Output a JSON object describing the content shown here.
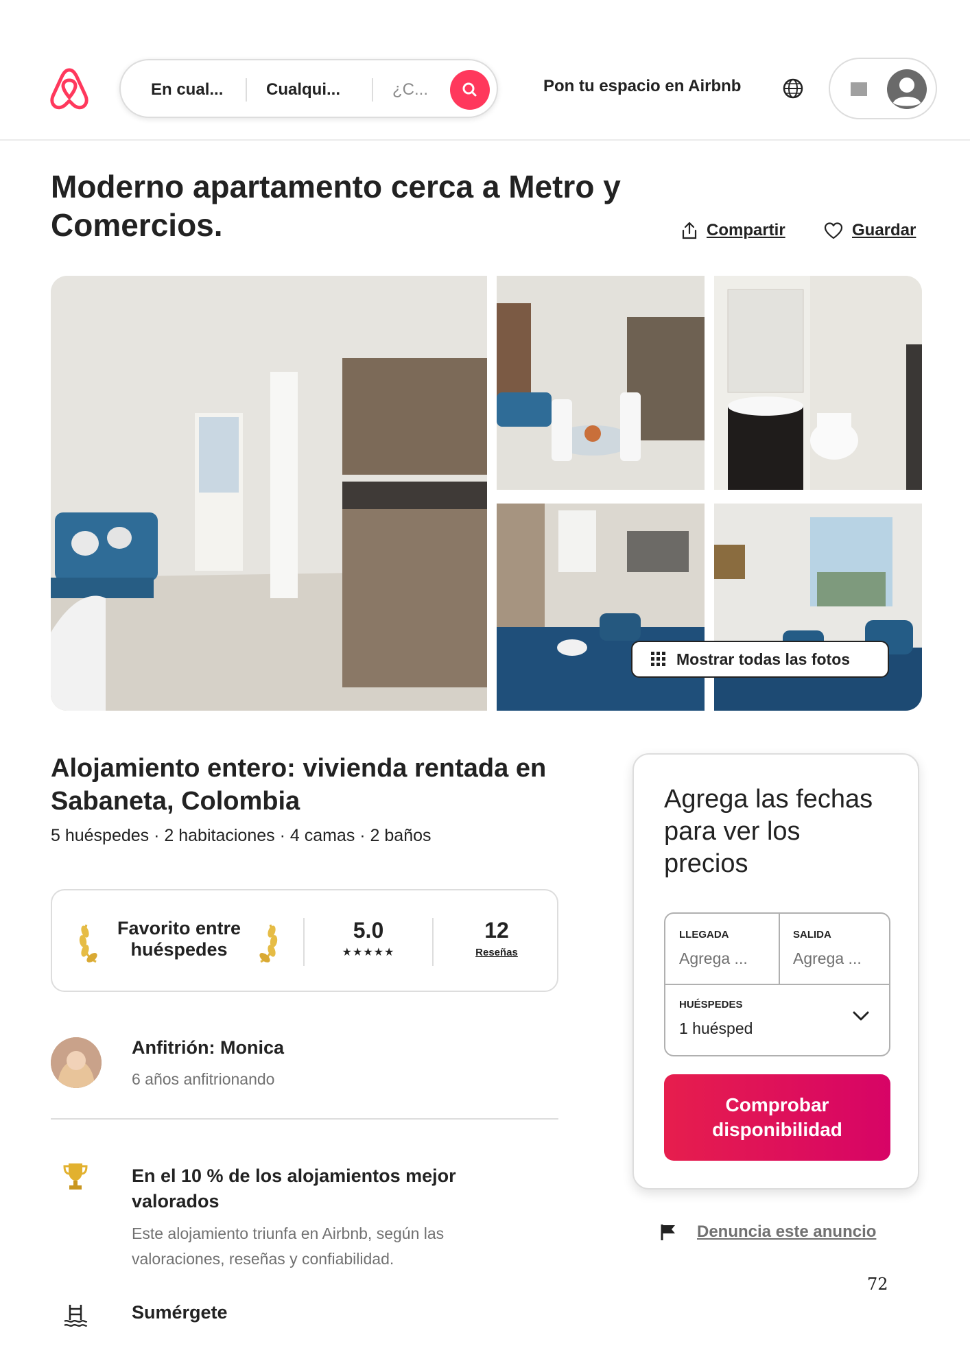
{
  "header": {
    "search": {
      "location": "En cual...",
      "dates": "Cualqui...",
      "guests": "¿C..."
    },
    "host_link": "Pon tu espacio en Airbnb"
  },
  "listing": {
    "title": "Moderno apartamento cerca a Metro y Comercios.",
    "share_label": "Compartir",
    "save_label": "Guardar",
    "show_all_photos": "Mostrar todas las fotos",
    "subtitle": "Alojamiento entero: vivienda rentada en Sabaneta, Colombia",
    "meta": "5 huéspedes · 2 habitaciones · 4 camas · 2 baños"
  },
  "favorite": {
    "label": "Favorito entre huéspedes",
    "rating": "5.0",
    "stars": "★★★★★",
    "reviews_count": "12",
    "reviews_label": "Reseñas"
  },
  "host": {
    "name": "Anfitrión: Monica",
    "years": "6 años anfitrionando"
  },
  "highlights": [
    {
      "icon": "trophy-icon",
      "title": "En el 10 % de los alojamientos mejor valorados",
      "description": "Este alojamiento triunfa en Airbnb, según las valoraciones, reseñas y confiabilidad."
    },
    {
      "icon": "pool-icon",
      "title": "Sumérgete"
    }
  ],
  "booking": {
    "prompt": "Agrega las fechas para ver los precios",
    "checkin_label": "LLEGADA",
    "checkin_value": "Agrega ...",
    "checkout_label": "SALIDA",
    "checkout_value": "Agrega ...",
    "guests_label": "HUÉSPEDES",
    "guests_value": "1 huésped",
    "check_button": "Comprobar disponibilidad"
  },
  "report_link": "Denuncia este anuncio",
  "page_number": "72",
  "colors": {
    "brand": "#ff385c",
    "cta_start": "#e61e4d",
    "cta_end": "#d70466",
    "text": "#222222",
    "muted": "#717171"
  }
}
